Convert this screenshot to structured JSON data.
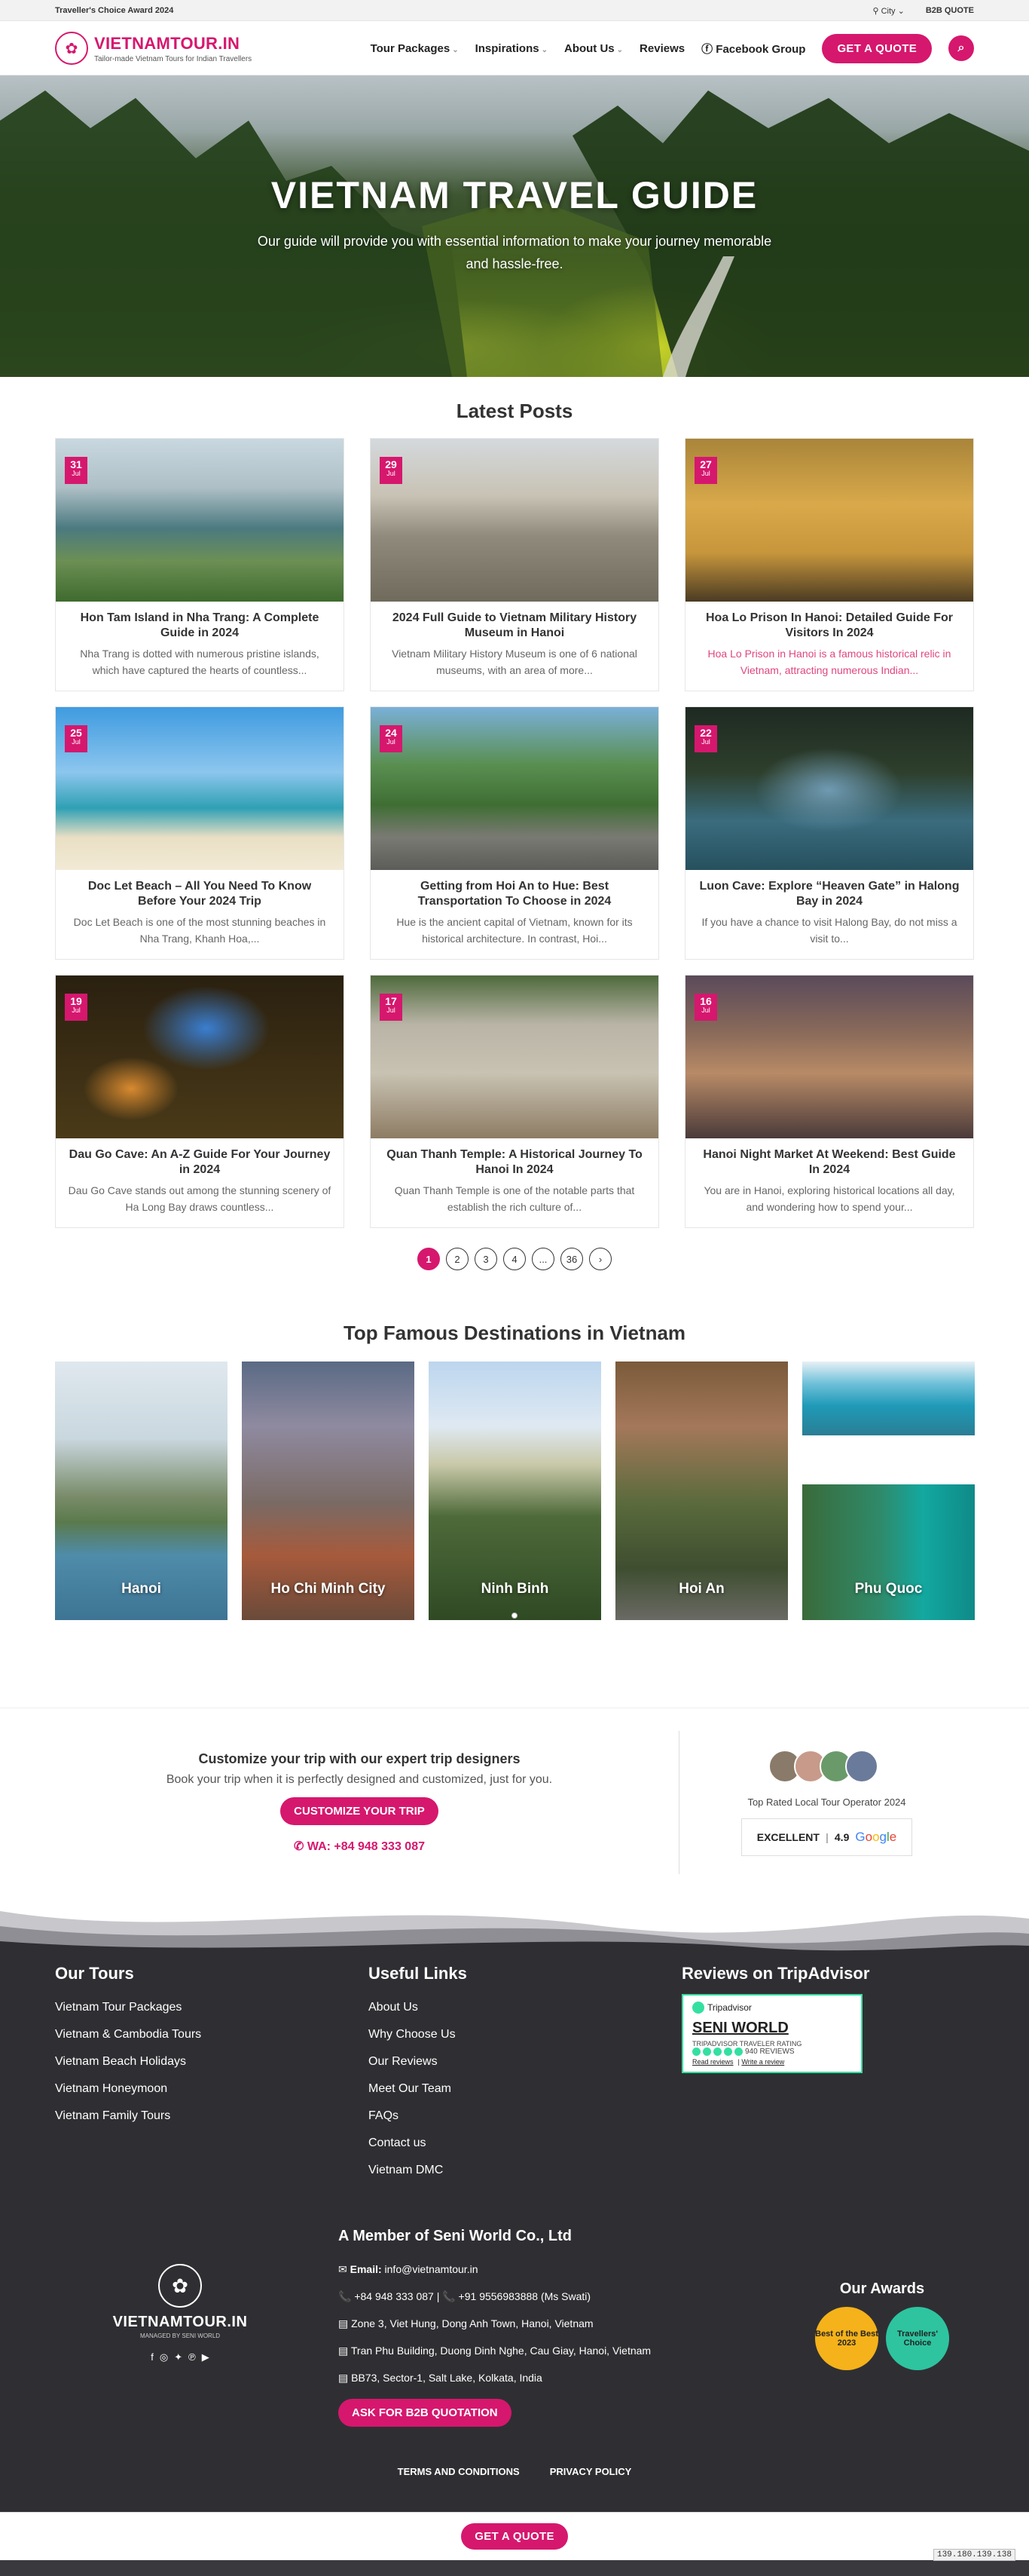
{
  "topbar": {
    "award": "Traveller's Choice Award 2024",
    "city": "City",
    "b2b": "B2B QUOTE"
  },
  "brand": {
    "name": "VIETNAMTOUR.IN",
    "tagline": "Tailor-made Vietnam Tours for Indian Travellers"
  },
  "nav": {
    "items": [
      "Tour Packages",
      "Inspirations",
      "About Us",
      "Reviews",
      "Facebook Group"
    ],
    "quote": "GET A QUOTE"
  },
  "hero": {
    "title": "VIETNAM TRAVEL GUIDE",
    "subtitle": "Our guide will provide you with essential information to make your journey memorable and hassle-free."
  },
  "posts": {
    "heading": "Latest Posts",
    "items": [
      {
        "day": "31",
        "month": "Jul",
        "title": "Hon Tam Island in Nha Trang: A Complete Guide in 2024",
        "excerpt": "Nha Trang is dotted with numerous pristine islands, which have captured the hearts of countless..."
      },
      {
        "day": "29",
        "month": "Jul",
        "title": "2024 Full Guide to Vietnam Military History Museum in Hanoi",
        "excerpt": "Vietnam Military History Museum is one of 6 national museums, with an area of more..."
      },
      {
        "day": "27",
        "month": "Jul",
        "title": "Hoa Lo Prison In Hanoi: Detailed Guide For Visitors In 2024",
        "excerpt": "Hoa Lo Prison in Hanoi is a famous historical relic in Vietnam, attracting numerous Indian..."
      },
      {
        "day": "25",
        "month": "Jul",
        "title": "Doc Let Beach – All You Need To Know Before Your 2024 Trip",
        "excerpt": "Doc Let Beach is one of the most stunning beaches in Nha Trang, Khanh Hoa,..."
      },
      {
        "day": "24",
        "month": "Jul",
        "title": "Getting from Hoi An to Hue: Best Transportation To Choose in 2024",
        "excerpt": "Hue is the ancient capital of Vietnam, known for its historical architecture. In contrast, Hoi..."
      },
      {
        "day": "22",
        "month": "Jul",
        "title": "Luon Cave: Explore “Heaven Gate” in Halong Bay in 2024",
        "excerpt": "If you have a chance to visit Halong Bay, do not miss a visit to..."
      },
      {
        "day": "19",
        "month": "Jul",
        "title": "Dau Go Cave: An A-Z Guide For Your Journey in 2024",
        "excerpt": "Dau Go Cave stands out among the stunning scenery of Ha Long Bay draws countless..."
      },
      {
        "day": "17",
        "month": "Jul",
        "title": "Quan Thanh Temple: A Historical Journey To Hanoi In 2024",
        "excerpt": "Quan Thanh Temple is one of the notable parts that establish the rich culture of..."
      },
      {
        "day": "16",
        "month": "Jul",
        "title": "Hanoi Night Market At Weekend: Best Guide In 2024",
        "excerpt": "You are in Hanoi, exploring historical locations all day, and wondering how to spend your..."
      }
    ]
  },
  "pagination": [
    "1",
    "2",
    "3",
    "4",
    "...",
    "36",
    "›"
  ],
  "destinations": {
    "heading": "Top Famous Destinations in Vietnam",
    "items": [
      "Hanoi",
      "Ho Chi Minh City",
      "Ninh Binh",
      "Hoi An",
      "Phu Quoc"
    ]
  },
  "customize": {
    "heading": "Customize your trip with our expert trip designers",
    "text": "Book your trip when it is perfectly designed and customized, just for you.",
    "button": "CUSTOMIZE YOUR TRIP",
    "whatsapp": "WA: +84 948 333 087",
    "top_rated": "Top Rated Local Tour Operator 2024",
    "excellent": "EXCELLENT",
    "rating": "4.9",
    "google": [
      "G",
      "o",
      "o",
      "g",
      "l",
      "e"
    ]
  },
  "footer": {
    "tours_heading": "Our Tours",
    "tours": [
      "Vietnam Tour Packages",
      "Vietnam & Cambodia Tours",
      "Vietnam Beach Holidays",
      "Vietnam Honeymoon",
      "Vietnam Family Tours"
    ],
    "links_heading": "Useful Links",
    "links": [
      "About Us",
      "Why Choose Us",
      "Our Reviews",
      "Meet Our Team",
      "FAQs",
      "Contact us",
      "Vietnam DMC"
    ],
    "reviews_heading": "Reviews on TripAdvisor",
    "tripadvisor": {
      "brand": "Tripadvisor",
      "name": "SENI WORLD",
      "rating_label": "TRIPADVISOR TRAVELER RATING",
      "reviews": "940 REVIEWS",
      "read": "Read reviews",
      "write": "Write a review"
    },
    "logo_name": "VIETNAMTOUR.IN",
    "logo_sub": "MANAGED BY SENI WORLD",
    "member_heading": "A Member of Seni World Co., Ltd",
    "email_label": "Email:",
    "email": "info@vietnamtour.in",
    "phones": "+84 948 333 087 | 📞 +91 9556983888 (Ms Swati)",
    "addresses": [
      "Zone 3, Viet Hung, Dong Anh Town, Hanoi, Vietnam",
      "Tran Phu Building, Duong Dinh Nghe, Cau Giay, Hanoi, Vietnam",
      "BB73, Sector-1, Salt Lake, Kolkata, India"
    ],
    "b2b_button": "ASK FOR B2B QUOTATION",
    "awards_heading": "Our Awards",
    "award1": "Best of the Best 2023",
    "award2": "Travellers' Choice",
    "terms": "TERMS AND CONDITIONS",
    "privacy": "PRIVACY POLICY",
    "quote": "GET A QUOTE",
    "ip": "139.180.139.138"
  },
  "colors": {
    "accent": "#d6176e",
    "footer_bg": "#2f2f33",
    "tripadvisor": "#34e0a1"
  }
}
